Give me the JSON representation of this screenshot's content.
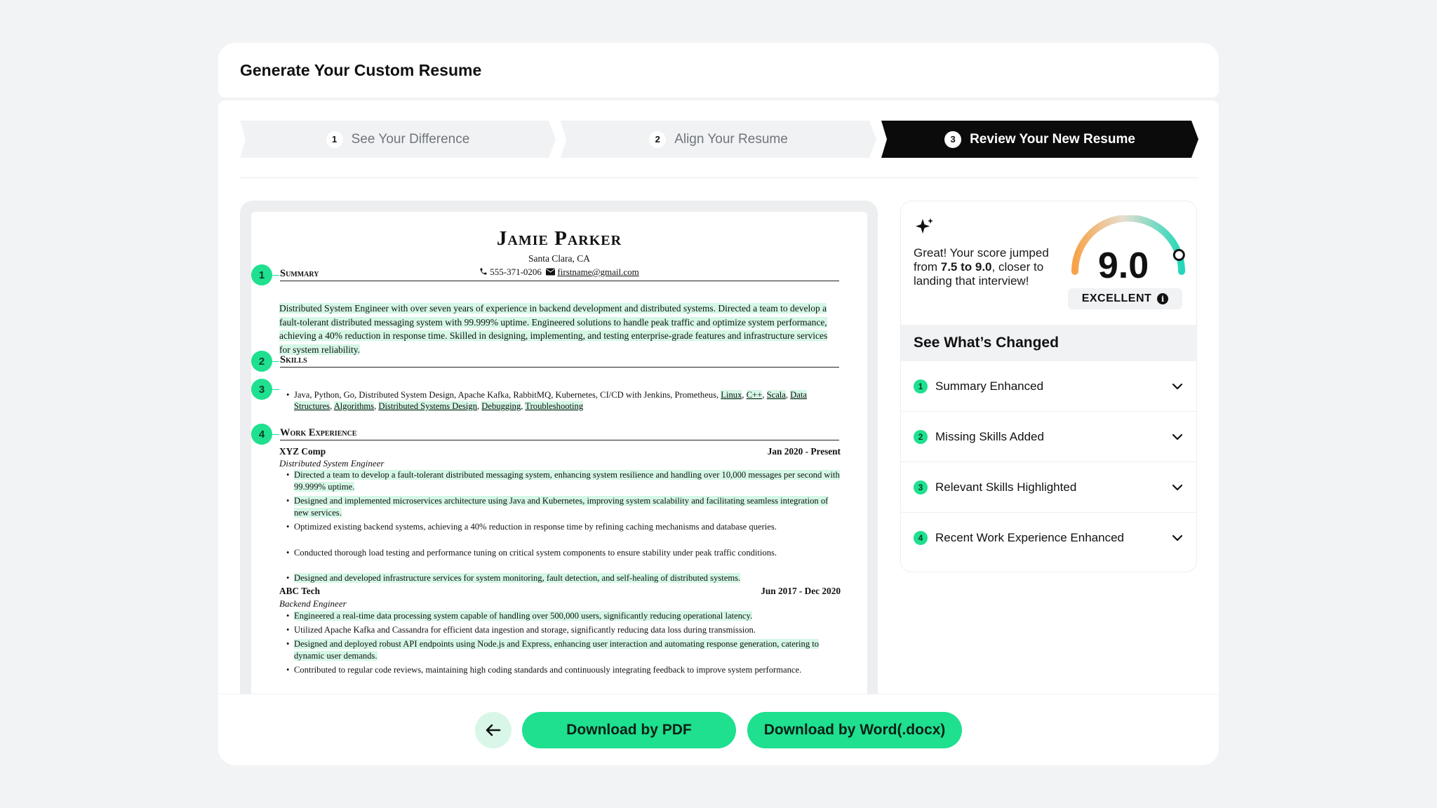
{
  "header": {
    "title": "Generate Your Custom Resume"
  },
  "steps": [
    {
      "num": "1",
      "label": "See Your Difference",
      "active": false
    },
    {
      "num": "2",
      "label": "Align Your Resume",
      "active": false
    },
    {
      "num": "3",
      "label": "Review Your New Resume",
      "active": true
    }
  ],
  "resume": {
    "name": "Jamie Parker",
    "location": "Santa Clara, CA",
    "phone": "555-371-0206",
    "email": "firstname@gmail.com",
    "sections": {
      "summary": "Summary",
      "skills": "Skills",
      "work": "Work Experience"
    },
    "markers": [
      "1",
      "2",
      "3",
      "4"
    ],
    "summary_text": "Distributed System Engineer with over seven years of experience in backend development and distributed systems. Directed a team to develop a fault-tolerant distributed messaging system with 99.999% uptime. Engineered solutions to handle peak traffic and optimize system performance, achieving a 40% reduction in response time. Skilled in designing, implementing, and testing enterprise-grade features and infrastructure services for system reliability.",
    "skills_text": "Java, Python, Go, Distributed System Design, Apache Kafka, RabbitMQ, Kubernetes, CI/CD with Jenkins, Prometheus,",
    "skills_added": [
      "Linux",
      "C++",
      "Scala",
      "Data Structures",
      "Algorithms",
      "Distributed Systems Design",
      "Debugging",
      "Troubleshooting"
    ],
    "jobs": [
      {
        "company": "XYZ Comp",
        "dates": "Jan 2020 - Present",
        "role": "Distributed System Engineer",
        "bullets": [
          "Directed a team to develop a fault-tolerant distributed messaging system, enhancing system resilience and handling over 10,000 messages per second with 99.999% uptime.",
          "Designed and implemented microservices architecture using Java and Kubernetes, improving system scalability and facilitating seamless integration of new services.",
          "Optimized existing backend systems, achieving a 40% reduction in response time by refining caching mechanisms and database queries.",
          "Conducted thorough load testing and performance tuning on critical system components to ensure stability under peak traffic conditions.",
          "Designed and developed infrastructure services for system monitoring, fault detection, and self-healing of distributed systems."
        ]
      },
      {
        "company": "ABC Tech",
        "dates": "Jun 2017 - Dec 2020",
        "role": "Backend Engineer",
        "bullets": [
          "Engineered a real-time data processing system capable of handling over 500,000 users, significantly reducing operational latency.",
          "Utilized Apache Kafka and Cassandra for efficient data ingestion and storage, significantly reducing data loss during transmission.",
          "Designed and deployed robust API endpoints using Node.js and Express, enhancing user interaction and automating response generation, catering to dynamic user demands.",
          "Contributed to regular code reviews, maintaining high coding standards and continuously integrating feedback to improve system performance."
        ]
      }
    ]
  },
  "score": {
    "message_prefix": "Great! Your score jumped from ",
    "message_bold": "7.5 to 9.0",
    "message_suffix": ", closer to landing that interview!",
    "value": "9.0",
    "value_numeric": 9.0,
    "max": 10,
    "rating": "EXCELLENT",
    "info_glyph": "i"
  },
  "changes": {
    "title": "See What’s Changed",
    "items": [
      {
        "num": "1",
        "label": "Summary Enhanced"
      },
      {
        "num": "2",
        "label": "Missing Skills Added"
      },
      {
        "num": "3",
        "label": "Relevant Skills Highlighted"
      },
      {
        "num": "4",
        "label": "Recent Work Experience Enhanced"
      }
    ]
  },
  "actions": {
    "download_pdf": "Download by PDF",
    "download_word": "Download by Word(.docx)"
  },
  "colors": {
    "accent": "#1EE08F",
    "highlight": "#D5F7E6",
    "active_step": "#0B0B0B",
    "inactive_step": "#F1F2F4"
  }
}
